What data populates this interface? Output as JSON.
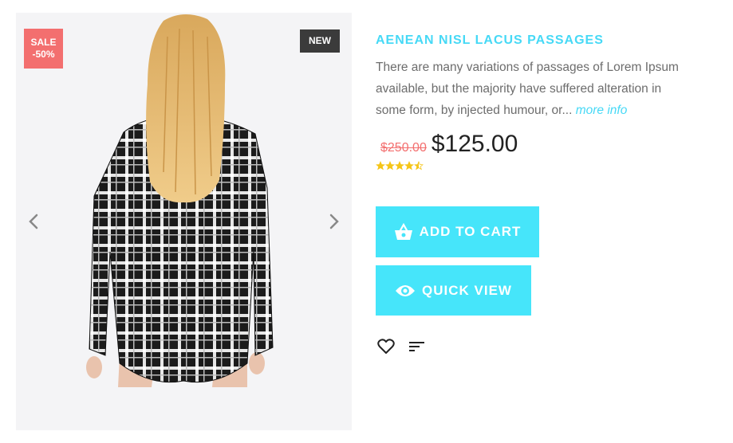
{
  "badges": {
    "sale_line1": "SALE",
    "sale_line2": "-50%",
    "new": "NEW"
  },
  "gallery": {
    "prev_icon": "chevron-left-icon",
    "next_icon": "chevron-right-icon"
  },
  "product": {
    "title": "AENEAN NISL LACUS PASSAGES",
    "description": "There are many variations of passages of Lorem Ipsum available, but the majority have suffered alteration in some form, by injected humour, or...",
    "more_info": "more info",
    "old_price": "$250.00",
    "price": "$125.00",
    "rating": 4.5,
    "rating_max": 5
  },
  "actions": {
    "add_to_cart": "ADD TO CART",
    "add_to_cart_icon": "basket-icon",
    "quick_view": "QUICK VIEW",
    "quick_view_icon": "eye-icon",
    "wishlist_icon": "heart-icon",
    "compare_icon": "sort-lines-icon"
  },
  "colors": {
    "accent": "#46d9f6",
    "button": "#46e5fa",
    "sale": "#f36f6f",
    "new_badge": "#3b3b3b",
    "star": "#f5c518"
  }
}
